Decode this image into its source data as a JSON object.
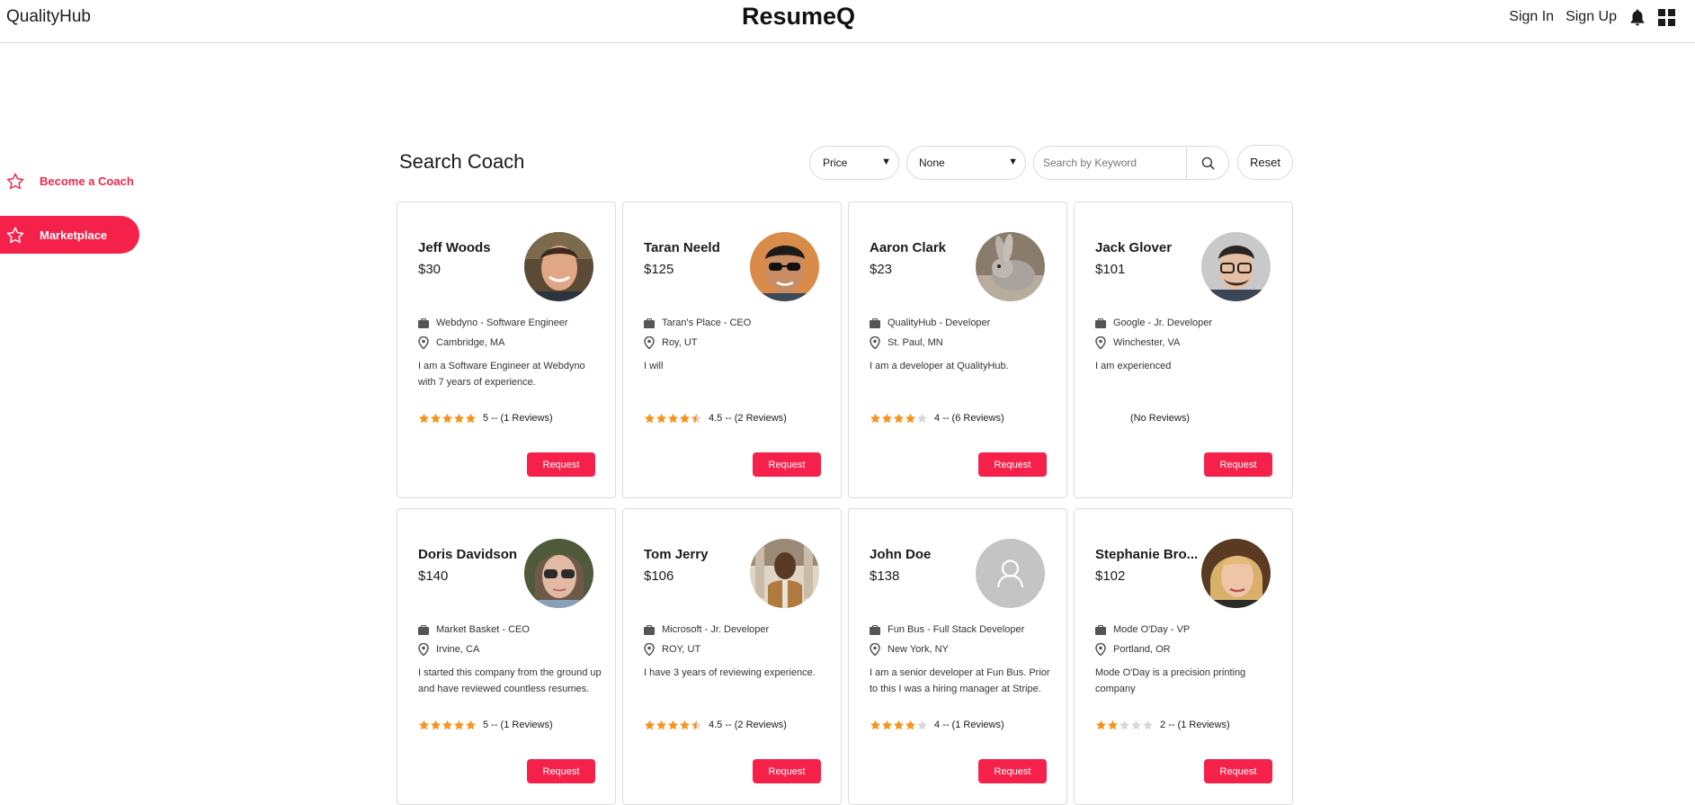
{
  "header": {
    "brand": "QualityHub",
    "title": "ResumeQ",
    "sign_in": "Sign In",
    "sign_up": "Sign Up",
    "bell_icon": "bell-icon",
    "apps_icon": "apps-grid-icon"
  },
  "sidebar": {
    "items": [
      {
        "label": "Become a Coach",
        "icon": "star-outline-icon",
        "active": false
      },
      {
        "label": "Marketplace",
        "icon": "star-outline-icon",
        "active": true
      }
    ]
  },
  "main": {
    "title": "Search Coach",
    "filters": {
      "price_selected": "Price",
      "sort_selected": "None",
      "search_placeholder": "Search by Keyword",
      "search_value": "",
      "reset_label": "Reset"
    }
  },
  "coaches": [
    {
      "name": "Jeff Woods",
      "price": "$30",
      "job": "Webdyno - Software Engineer",
      "location": "Cambridge, MA",
      "bio": "I am a Software Engineer at Webdyno with 7 years of experience.",
      "rating": 5,
      "rating_text": "5 -- (1 Reviews)",
      "request": "Request",
      "avatar": "photo-man-smiling"
    },
    {
      "name": "Taran Neeld",
      "price": "$125",
      "job": "Taran's Place - CEO",
      "location": "Roy, UT",
      "bio": "I will",
      "rating": 4.5,
      "rating_text": "4.5 -- (2 Reviews)",
      "request": "Request",
      "avatar": "photo-man-sunglasses"
    },
    {
      "name": "Aaron Clark",
      "price": "$23",
      "job": "QualityHub - Developer",
      "location": "St. Paul, MN",
      "bio": "I am a developer at QualityHub.",
      "rating": 4,
      "rating_text": "4 -- (6 Reviews)",
      "request": "Request",
      "avatar": "photo-rabbit"
    },
    {
      "name": "Jack Glover",
      "price": "$101",
      "job": "Google - Jr. Developer",
      "location": "Winchester, VA",
      "bio": "I am experienced",
      "rating": 0,
      "rating_text": "(No Reviews)",
      "request": "Request",
      "avatar": "photo-man-glasses"
    },
    {
      "name": "Doris Davidson",
      "price": "$140",
      "job": "Market Basket - CEO",
      "location": "Irvine, CA",
      "bio": "I started this company from the ground up and have reviewed countless resumes.",
      "rating": 5,
      "rating_text": "5 -- (1 Reviews)",
      "request": "Request",
      "avatar": "photo-woman-sunglasses"
    },
    {
      "name": "Tom Jerry",
      "price": "$106",
      "job": "Microsoft - Jr. Developer",
      "location": "ROY, UT",
      "bio": "I have 3 years of reviewing experience.",
      "rating": 4.5,
      "rating_text": "4.5 -- (2 Reviews)",
      "request": "Request",
      "avatar": "photo-man-suit"
    },
    {
      "name": "John Doe",
      "price": "$138",
      "job": "Fun Bus - Full Stack Developer",
      "location": "New York, NY",
      "bio": "I am a senior developer at Fun Bus. Prior to this I was a hiring manager at Stripe.",
      "rating": 4,
      "rating_text": "4 -- (1 Reviews)",
      "request": "Request",
      "avatar": "placeholder-user-icon"
    },
    {
      "name": "Stephanie Bro...",
      "price": "$102",
      "job": "Mode O'Day - VP",
      "location": "Portland, OR",
      "bio": "Mode O'Day is a precision printing company",
      "rating": 2,
      "rating_text": "2 -- (1 Reviews)",
      "request": "Request",
      "avatar": "photo-woman-blonde"
    }
  ],
  "colors": {
    "accent": "#f6214a",
    "star_filled": "#f7941d",
    "star_empty": "#d9d9d9",
    "border": "#dcdcdc"
  }
}
